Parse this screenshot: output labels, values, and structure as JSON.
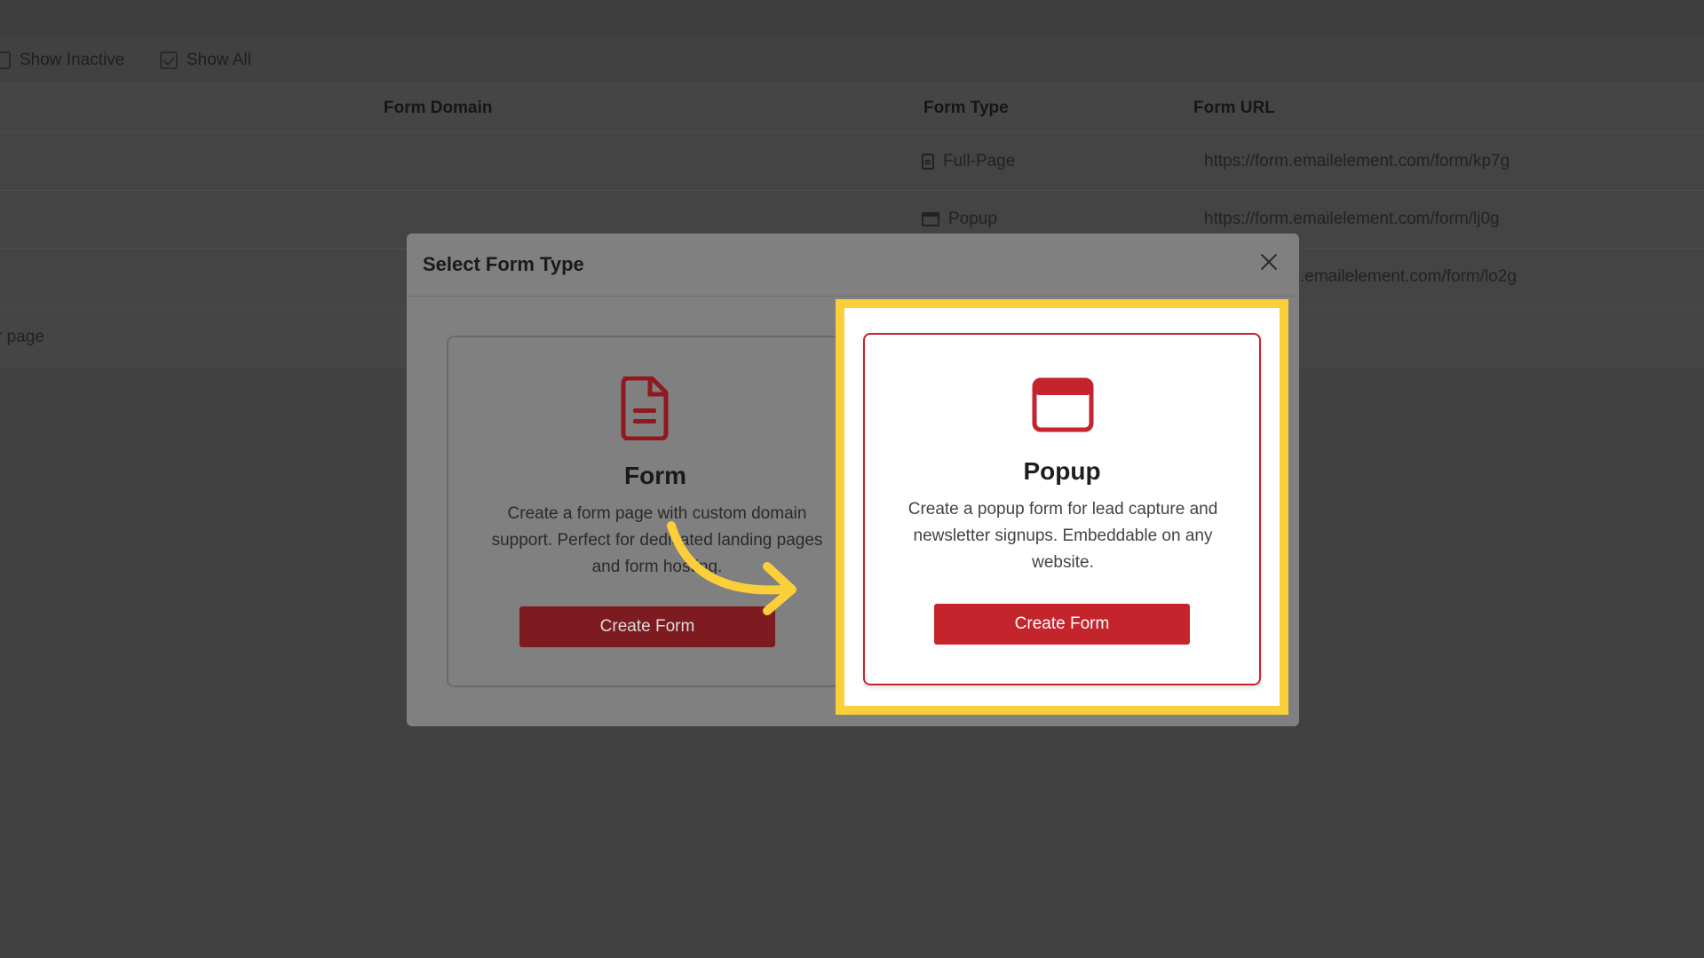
{
  "toolbar": {
    "show_inactive_label": "Show Inactive",
    "show_all_label": "Show All"
  },
  "table": {
    "headers": {
      "form_domain": "Form Domain",
      "form_type": "Form Type",
      "form_url": "Form URL"
    },
    "rows": [
      {
        "type": "Full-Page",
        "type_icon": "document-icon",
        "url": "https://form.emailelement.com/form/kp7g"
      },
      {
        "type": "Popup",
        "type_icon": "window-icon",
        "url": "https://form.emailelement.com/form/lj0g"
      },
      {
        "type": "",
        "type_icon": "",
        "url": ".emailelement.com/form/lo2g"
      }
    ],
    "footer_text": "r page"
  },
  "modal": {
    "title": "Select Form Type",
    "cards": [
      {
        "icon": "document-icon",
        "title": "Form",
        "description": "Create a form page with custom domain support. Perfect for dedicated landing pages and form hosting.",
        "button_label": "Create Form"
      },
      {
        "icon": "popup-window-icon",
        "title": "Popup",
        "description": "Create a popup form for lead capture and newsletter signups. Embeddable on any website.",
        "button_label": "Create Form"
      }
    ]
  },
  "colors": {
    "accent_red": "#c4242c",
    "highlight_yellow": "#fbcf3a",
    "overlay": "#414141"
  }
}
